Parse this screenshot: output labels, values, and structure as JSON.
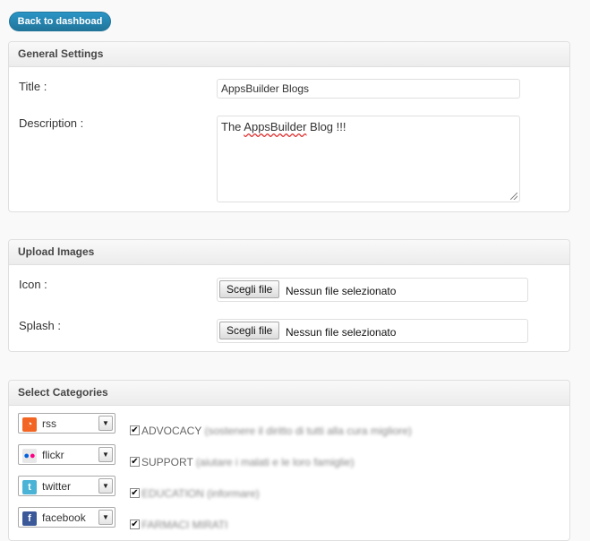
{
  "header": {
    "back_label": "Back to dashboad"
  },
  "general": {
    "heading": "General Settings",
    "title_label": "Title :",
    "title_value": "AppsBuilder Blogs",
    "description_label": "Description :",
    "description_prefix": "The ",
    "description_spell": "AppsBuilder",
    "description_suffix": " Blog !!!"
  },
  "upload": {
    "heading": "Upload Images",
    "icon_label": "Icon :",
    "splash_label": "Splash :",
    "choose_label": "Scegli file",
    "no_file_label": "Nessun file selezionato"
  },
  "categories": {
    "heading": "Select Categories",
    "rows": [
      {
        "service": "rss",
        "icon": "rss-icon",
        "icon_color": "#f26522",
        "checked": true,
        "name": "ADVOCACY",
        "detail": "(sostenere il diritto di tutti alla cura migliore)"
      },
      {
        "service": "flickr",
        "icon": "flickr-icon",
        "icon_color": "#e8e8e8",
        "checked": true,
        "name": "SUPPORT",
        "detail": "(aiutare i malati e le loro famiglie)"
      },
      {
        "service": "twitter",
        "icon": "twitter-icon",
        "icon_color": "#4ab3d6",
        "checked": true,
        "name": "EDUCATION",
        "detail": "(informare)"
      },
      {
        "service": "facebook",
        "icon": "facebook-icon",
        "icon_color": "#3b5998",
        "checked": true,
        "name": "FARMACI MIRATI",
        "detail": ""
      }
    ]
  }
}
